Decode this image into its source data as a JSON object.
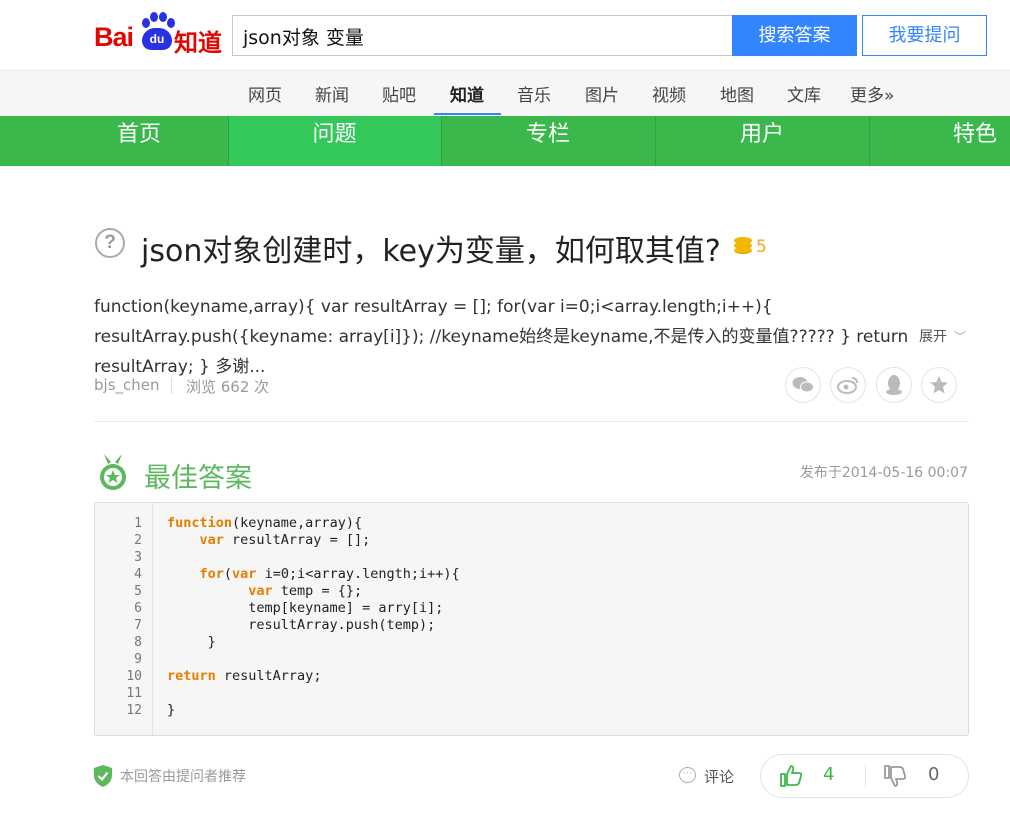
{
  "header": {
    "logo_text_red": "Bai",
    "logo_text_paw": "du",
    "logo_text_zhidao": "知道",
    "search_value": "json对象 变量",
    "search_button": "搜索答案",
    "ask_button": "我要提问"
  },
  "nav": {
    "items": [
      "网页",
      "新闻",
      "贴吧",
      "知道",
      "音乐",
      "图片",
      "视频",
      "地图",
      "文库",
      "更多»"
    ],
    "active": "知道"
  },
  "green_nav": {
    "items": [
      "首页",
      "问题",
      "专栏",
      "用户",
      "特色"
    ],
    "active": "问题"
  },
  "question": {
    "icon": "question-circle-icon",
    "title": "json对象创建时，key为变量，如何取其值?",
    "reward": "5",
    "body": "function(keyname,array){ var resultArray = []; for(var i=0;i<array.length;i++){ resultArray.push({keyname: array[i]}); //keyname始终是keyname,不是传入的变量值????? } return resultArray; } 多谢...",
    "expand_label": "展开",
    "user": "bjs_chen",
    "views": "浏览 662 次",
    "share_icons": [
      "wechat-icon",
      "weibo-icon",
      "qq-icon",
      "favorite-star-icon"
    ]
  },
  "best_answer": {
    "title": "最佳答案",
    "date": "发布于2014-05-16 00:07",
    "code_lines": [
      "function(keyname,array){",
      "    var resultArray = [];",
      "",
      "    for(var i=0;i<array.length;i++){",
      "          var temp = {};",
      "          temp[keyname] = arry[i];",
      "          resultArray.push(temp);",
      "     }",
      "",
      "return resultArray;",
      "",
      "}"
    ],
    "recommended_text": "本回答由提问者推荐",
    "comment_label": "评论",
    "upvotes": "4",
    "downvotes": "0"
  },
  "colors": {
    "baidu_red": "#e10602",
    "baidu_blue": "#2932e1",
    "search_blue": "#3385ff",
    "green": "#3ab84b",
    "answer_green": "#5cb85c",
    "keyword_orange": "#e67e00"
  }
}
